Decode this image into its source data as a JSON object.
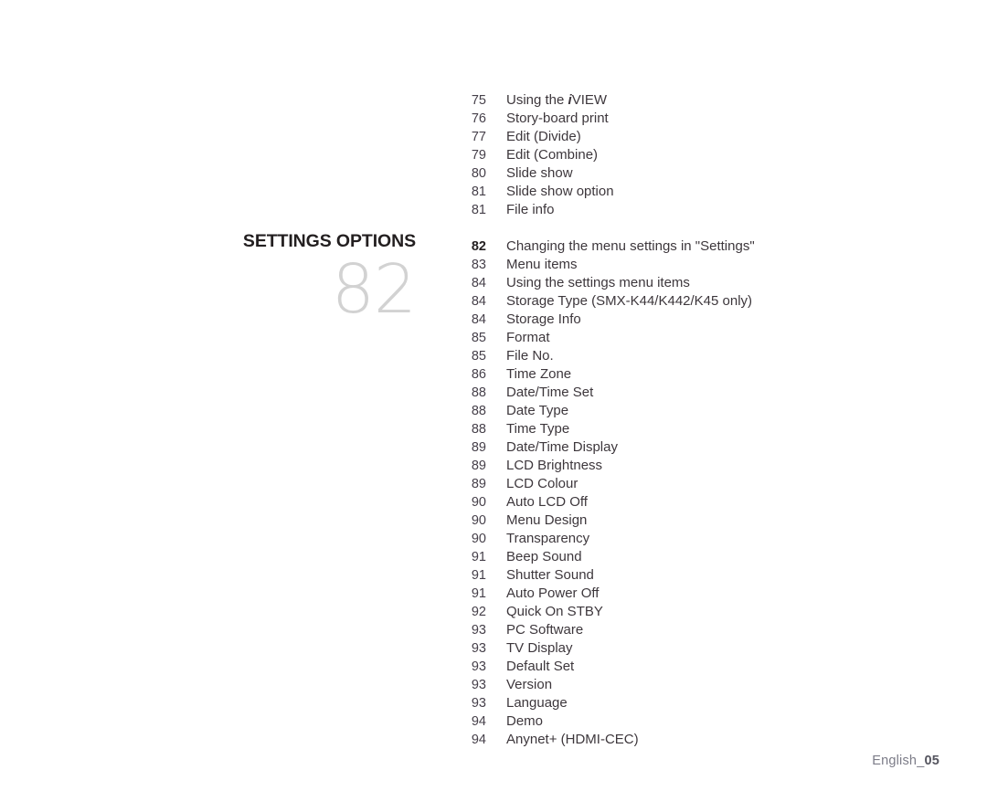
{
  "page": {
    "background_color": "#ffffff",
    "text_color": "#3d373c",
    "accent_color": "#231f20",
    "watermark_color": "#d2d2d2"
  },
  "section": {
    "title": "SETTINGS OPTIONS",
    "watermark_number": "82"
  },
  "toc": {
    "groups": [
      {
        "id": "group-preceding",
        "rows": [
          {
            "page": "75",
            "label_prefix": "Using the ",
            "label_em": "i",
            "label_suffix": "VIEW",
            "bold": false
          },
          {
            "page": "76",
            "label": "Story-board print",
            "bold": false
          },
          {
            "page": "77",
            "label": "Edit (Divide)",
            "bold": false
          },
          {
            "page": "79",
            "label": "Edit (Combine)",
            "bold": false
          },
          {
            "page": "80",
            "label": "Slide show",
            "bold": false
          },
          {
            "page": "81",
            "label": "Slide show option",
            "bold": false
          },
          {
            "page": "81",
            "label": "File info",
            "bold": false
          }
        ]
      },
      {
        "id": "group-settings-options",
        "rows": [
          {
            "page": "82",
            "label": "Changing the menu settings in \"Settings\"",
            "bold": true
          },
          {
            "page": "83",
            "label": "Menu items",
            "bold": false
          },
          {
            "page": "84",
            "label": "Using the settings menu items",
            "bold": false
          },
          {
            "page": "84",
            "label": "Storage Type (SMX-K44/K442/K45 only)",
            "bold": false
          },
          {
            "page": "84",
            "label": "Storage Info",
            "bold": false
          },
          {
            "page": "85",
            "label": "Format",
            "bold": false
          },
          {
            "page": "85",
            "label": "File No.",
            "bold": false
          },
          {
            "page": "86",
            "label": "Time Zone",
            "bold": false
          },
          {
            "page": "88",
            "label": "Date/Time Set",
            "bold": false
          },
          {
            "page": "88",
            "label": "Date Type",
            "bold": false
          },
          {
            "page": "88",
            "label": "Time Type",
            "bold": false
          },
          {
            "page": "89",
            "label": "Date/Time Display",
            "bold": false
          },
          {
            "page": "89",
            "label": "LCD Brightness",
            "bold": false
          },
          {
            "page": "89",
            "label": "LCD Colour",
            "bold": false
          },
          {
            "page": "90",
            "label": "Auto LCD Off",
            "bold": false
          },
          {
            "page": "90",
            "label": "Menu Design",
            "bold": false
          },
          {
            "page": "90",
            "label": "Transparency",
            "bold": false
          },
          {
            "page": "91",
            "label": "Beep Sound",
            "bold": false
          },
          {
            "page": "91",
            "label": "Shutter Sound",
            "bold": false
          },
          {
            "page": "91",
            "label": "Auto Power Off",
            "bold": false
          },
          {
            "page": "92",
            "label": "Quick On STBY",
            "bold": false
          },
          {
            "page": "93",
            "label": "PC Software",
            "bold": false
          },
          {
            "page": "93",
            "label": "TV Display",
            "bold": false
          },
          {
            "page": "93",
            "label": "Default Set",
            "bold": false
          },
          {
            "page": "93",
            "label": "Version",
            "bold": false
          },
          {
            "page": "93",
            "label": "Language",
            "bold": false
          },
          {
            "page": "94",
            "label": "Demo",
            "bold": false
          },
          {
            "page": "94",
            "label": "Anynet+ (HDMI-CEC)",
            "bold": false
          }
        ]
      }
    ]
  },
  "footer": {
    "language": "English_",
    "page_number": "05"
  }
}
